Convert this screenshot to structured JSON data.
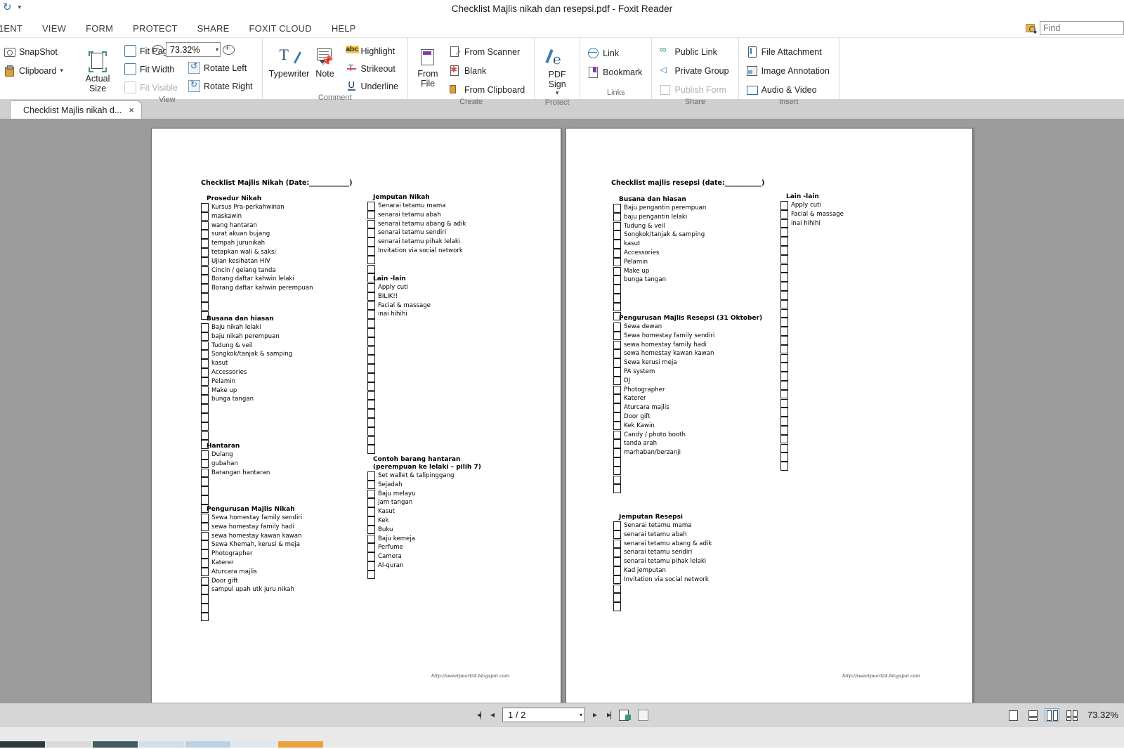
{
  "window": {
    "title": "Checklist Majlis nikah dan resepsi.pdf - Foxit Reader",
    "qat": {
      "refresh_icon": "refresh-icon",
      "dropdown_icon": "chevron-down-icon"
    }
  },
  "menubar": {
    "items": [
      "1ENT",
      "VIEW",
      "FORM",
      "PROTECT",
      "SHARE",
      "FOXIT CLOUD",
      "HELP"
    ],
    "find": {
      "placeholder": "Find",
      "icon": "find-search-icon"
    }
  },
  "ribbon": {
    "groups": [
      {
        "label": "",
        "buttons": [
          "SnapShot",
          "Clipboard"
        ]
      },
      {
        "label": "View",
        "actual_size": "Actual Size",
        "buttons": [
          "Fit Page",
          "Fit Width",
          "Fit Visible",
          "Rotate Left",
          "Rotate Right"
        ],
        "zoom_value": "73.32%"
      },
      {
        "label": "Comment",
        "big": [
          "Typewriter",
          "Note"
        ],
        "buttons": [
          "Highlight",
          "Strikeout",
          "Underline"
        ]
      },
      {
        "label": "Create",
        "big": [
          "From File"
        ],
        "buttons": [
          "From Scanner",
          "Blank",
          "From Clipboard"
        ]
      },
      {
        "label": "Protect",
        "big": [
          "PDF Sign"
        ]
      },
      {
        "label": "Links",
        "buttons": [
          "Link",
          "Bookmark"
        ]
      },
      {
        "label": "Share",
        "buttons": [
          "Public Link",
          "Private Group",
          "Publish Form"
        ]
      },
      {
        "label": "Insert",
        "buttons": [
          "File Attachment",
          "Image Annotation",
          "Audio & Video"
        ]
      }
    ]
  },
  "tabs": [
    {
      "label": "Checklist Majlis nikah d...",
      "close": "×"
    }
  ],
  "document": {
    "footer_url": "http://sweetpearl24.blogspot.com",
    "pages": [
      {
        "title": "Checklist Majlis Nikah (Date:____________)",
        "columns": [
          {
            "sections": [
              {
                "heading": "Prosedur Nikah",
                "items": [
                  "Kursus Pra-perkahwinan",
                  "maskawin",
                  "wang hantaran",
                  "surat akuan bujang",
                  "tempah jurunikah",
                  "tetapkan wali & saksi",
                  "Ujian kesihatan  HIV",
                  "Cincin / gelang tanda",
                  "Borang daftar kahwin lelaki",
                  "Borang daftar kahwin perempuan"
                ],
                "blank_rows": 3
              },
              {
                "heading": "Busana dan hiasan",
                "items": [
                  "Baju nikah lelaki",
                  "baju nikah perempuan",
                  "Tudung & veil",
                  "Songkok/tanjak & samping",
                  "kasut",
                  "Accessories",
                  "Pelamin",
                  "Make up",
                  "bunga tangan"
                ],
                "blank_rows": 5
              },
              {
                "heading": "Hantaran",
                "items": [
                  "Dulang",
                  "gubahan",
                  "Barangan hantaran"
                ],
                "blank_rows": 4
              },
              {
                "heading": "Pengurusan Majlis Nikah",
                "items": [
                  "Sewa homestay family sendiri",
                  "sewa homestay family hadi",
                  "sewa homestay kawan kawan",
                  "Sewa Khemah, kerusi & meja",
                  "Photographer",
                  "Katerer",
                  "Aturcara majlis",
                  "Door gift",
                  "sampul upah utk juru nikah"
                ],
                "blank_rows": 3
              }
            ]
          },
          {
            "sections": [
              {
                "heading": "Jemputan Nikah",
                "items": [
                  "Senarai tetamu mama",
                  "senarai tetamu abah",
                  "senarai tetamu abang & adik",
                  "senarai tetamu sendiri",
                  "senarai tetamu pihak lelaki",
                  "Invitation via social network"
                ],
                "blank_rows": 3
              },
              {
                "heading": "Lain -lain",
                "items": [
                  "Apply cuti",
                  "BILIK!!",
                  "Facial & massage",
                  "inai hihihi"
                ],
                "blank_rows": 15
              },
              {
                "heading": "Contoh barang hantaran",
                "heading2": "(perempuan ke lelaki – pilih 7)",
                "items": [
                  "Set wallet & talipinggang",
                  "Sejadah",
                  "Baju melayu",
                  "Jam tangan",
                  "Kasut",
                  "Kek",
                  "Buku",
                  "Baju kemeja",
                  "Perfume",
                  "Camera",
                  "Al-quran"
                ],
                "blank_rows": 1
              }
            ]
          }
        ]
      },
      {
        "title": "Checklist majlis resepsi (date:___________)",
        "columns": [
          {
            "sections": [
              {
                "heading": "Busana dan hiasan",
                "items": [
                  "Baju pengantin perempuan",
                  "baju pengantin lelaki",
                  "Tudung & veil",
                  "Songkok/tanjak & samping",
                  "kasut",
                  "Accessories",
                  "Pelamin",
                  "Make up",
                  "bunga tangan"
                ],
                "blank_rows": 4
              },
              {
                "heading": "Pengurusan Majlis Resepsi (31 Oktober)",
                "items": [
                  "Sewa dewan",
                  "Sewa homestay family sendiri",
                  "sewa homestay family hadi",
                  "sewa homestay kawan kawan",
                  "Sewa kerusi meja",
                  "PA system",
                  "DJ",
                  "Photographer",
                  "Katerer",
                  "Aturcara majlis",
                  "Door gift",
                  "Kek Kawin",
                  "Candy / photo booth",
                  "tanda arah",
                  "marhaban/berzanji"
                ],
                "blank_rows": 4
              },
              {
                "heading": "Jemputan Resepsi",
                "items": [
                  "Senarai tetamu mama",
                  "senarai tetamu abah",
                  "senarai tetamu abang & adik",
                  "senarai tetamu sendiri",
                  "senarai tetamu pihak lelaki",
                  "Kad jemputan",
                  "Invitation via social network"
                ],
                "blank_rows": 3
              }
            ]
          },
          {
            "sections": [
              {
                "heading": "Lain -lain",
                "items": [
                  "Apply cuti",
                  "Facial & massage",
                  "inai hihihi"
                ],
                "blank_rows": 27
              }
            ]
          }
        ]
      }
    ]
  },
  "statusbar": {
    "first_page_icon": "first-page-icon",
    "prev_page_icon": "previous-page-icon",
    "page_value": "1 / 2",
    "next_page_icon": "next-page-icon",
    "last_page_icon": "last-page-icon",
    "tool_icons": [
      "snapshot-tool-icon",
      "clipboard-tool-icon"
    ],
    "view_modes": [
      "single-page-view-icon",
      "continuous-scroll-view-icon",
      "facing-pages-view-icon",
      "continuous-facing-view-icon"
    ],
    "selected_view_mode_index": 2,
    "zoom": "73.32%"
  }
}
